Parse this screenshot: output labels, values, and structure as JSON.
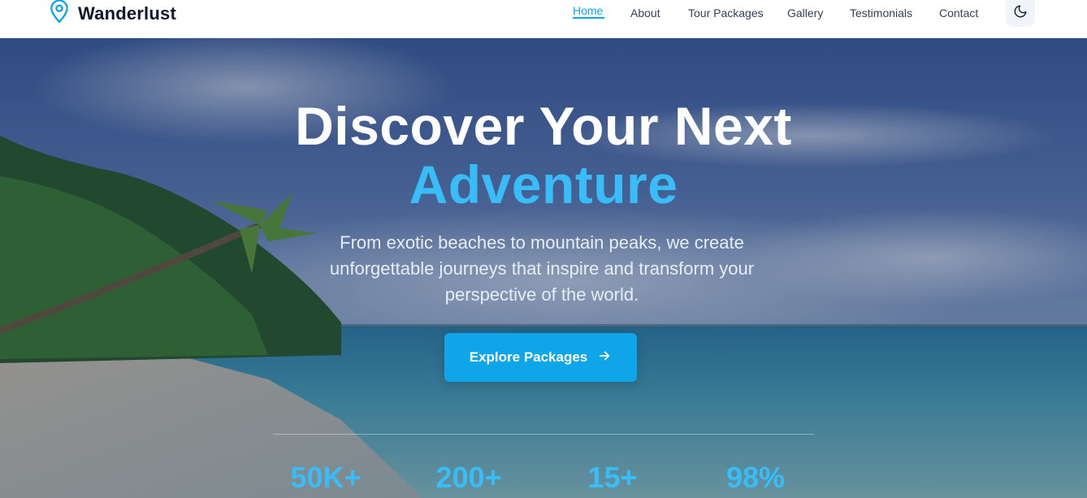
{
  "brand": {
    "name": "Wanderlust",
    "icon": "map-pin-icon"
  },
  "nav": {
    "items": [
      {
        "label": "Home",
        "active": true
      },
      {
        "label": "About",
        "active": false
      },
      {
        "label": "Tour Packages",
        "active": false
      },
      {
        "label": "Gallery",
        "active": false
      },
      {
        "label": "Testimonials",
        "active": false
      },
      {
        "label": "Contact",
        "active": false
      }
    ],
    "theme_toggle_icon": "moon-icon"
  },
  "hero": {
    "title_line1": "Discover Your Next",
    "title_line2": "Adventure",
    "subtitle": "From exotic beaches to mountain peaks, we create unforgettable journeys that inspire and transform your perspective of the world.",
    "cta_label": "Explore Packages",
    "cta_icon": "arrow-right-icon"
  },
  "stats": [
    {
      "value": "50K+"
    },
    {
      "value": "200+"
    },
    {
      "value": "15+"
    },
    {
      "value": "98%"
    }
  ],
  "colors": {
    "accent": "#0ea5e9",
    "accent_light": "#38bdf8",
    "text_dark": "#0f172a"
  }
}
